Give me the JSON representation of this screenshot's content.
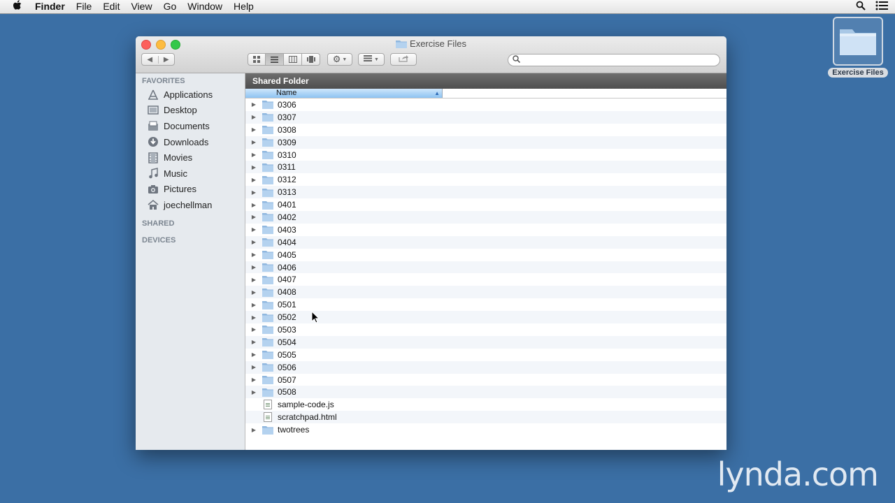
{
  "menubar": {
    "items": [
      "Finder",
      "File",
      "Edit",
      "View",
      "Go",
      "Window",
      "Help"
    ]
  },
  "desktop": {
    "icon_label": "Exercise Files"
  },
  "window": {
    "title": "Exercise Files",
    "search_placeholder": ""
  },
  "sidebar": {
    "favorites_header": "FAVORITES",
    "favorites": [
      {
        "label": "Applications",
        "icon": "applications-icon"
      },
      {
        "label": "Desktop",
        "icon": "desktop-icon"
      },
      {
        "label": "Documents",
        "icon": "documents-icon"
      },
      {
        "label": "Downloads",
        "icon": "downloads-icon"
      },
      {
        "label": "Movies",
        "icon": "movies-icon"
      },
      {
        "label": "Music",
        "icon": "music-icon"
      },
      {
        "label": "Pictures",
        "icon": "pictures-icon"
      },
      {
        "label": "joechellman",
        "icon": "home-icon"
      }
    ],
    "shared_header": "SHARED",
    "devices_header": "DEVICES"
  },
  "main": {
    "path_title": "Shared Folder",
    "column_name": "Name",
    "rows": [
      {
        "name": "0306",
        "type": "folder"
      },
      {
        "name": "0307",
        "type": "folder"
      },
      {
        "name": "0308",
        "type": "folder"
      },
      {
        "name": "0309",
        "type": "folder"
      },
      {
        "name": "0310",
        "type": "folder"
      },
      {
        "name": "0311",
        "type": "folder"
      },
      {
        "name": "0312",
        "type": "folder"
      },
      {
        "name": "0313",
        "type": "folder"
      },
      {
        "name": "0401",
        "type": "folder"
      },
      {
        "name": "0402",
        "type": "folder"
      },
      {
        "name": "0403",
        "type": "folder"
      },
      {
        "name": "0404",
        "type": "folder"
      },
      {
        "name": "0405",
        "type": "folder"
      },
      {
        "name": "0406",
        "type": "folder"
      },
      {
        "name": "0407",
        "type": "folder"
      },
      {
        "name": "0408",
        "type": "folder"
      },
      {
        "name": "0501",
        "type": "folder"
      },
      {
        "name": "0502",
        "type": "folder"
      },
      {
        "name": "0503",
        "type": "folder"
      },
      {
        "name": "0504",
        "type": "folder"
      },
      {
        "name": "0505",
        "type": "folder"
      },
      {
        "name": "0506",
        "type": "folder"
      },
      {
        "name": "0507",
        "type": "folder"
      },
      {
        "name": "0508",
        "type": "folder"
      },
      {
        "name": "sample-code.js",
        "type": "file"
      },
      {
        "name": "scratchpad.html",
        "type": "file"
      },
      {
        "name": "twotrees",
        "type": "folder"
      }
    ]
  },
  "watermark": "lynda.com",
  "colors": {
    "desktop_bg": "#3b6fa5",
    "sidebar_bg": "#e6eaee",
    "path_bar_bg": "#5a5a5a",
    "column_selected": "#9ecbf3",
    "folder_blue": "#8fb7df"
  }
}
